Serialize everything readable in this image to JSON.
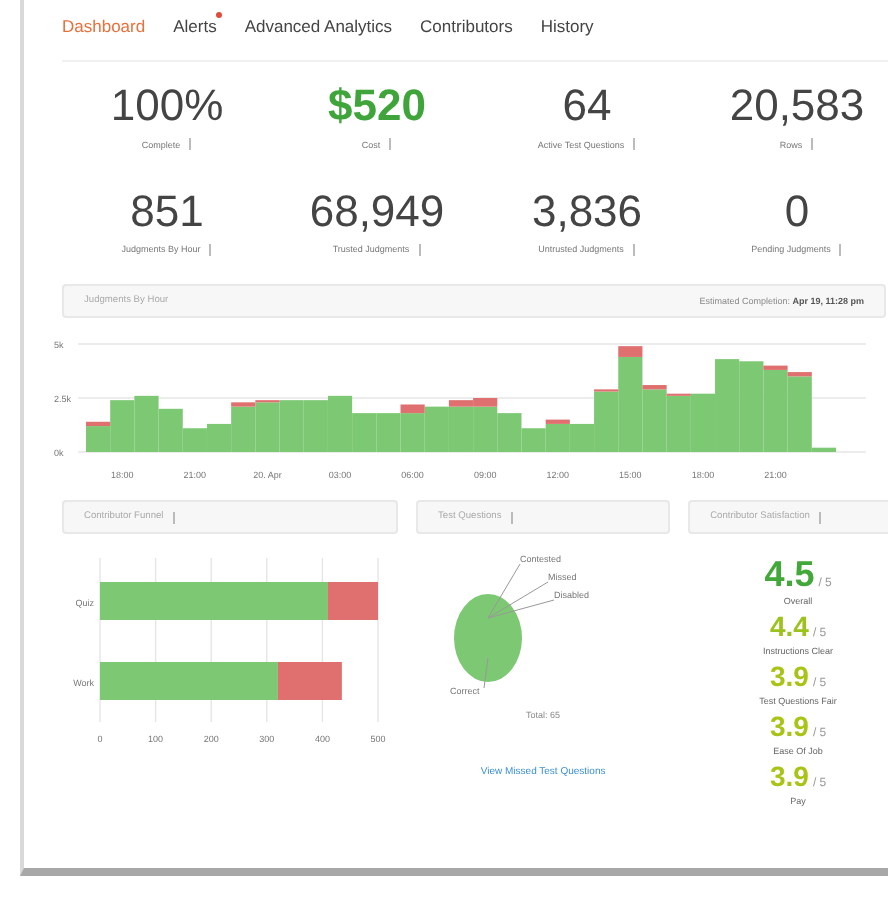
{
  "tabs": [
    {
      "label": "Dashboard",
      "selected": true,
      "alert": false
    },
    {
      "label": "Alerts",
      "selected": false,
      "alert": true
    },
    {
      "label": "Advanced Analytics",
      "selected": false,
      "alert": false
    },
    {
      "label": "Contributors",
      "selected": false,
      "alert": false
    },
    {
      "label": "History",
      "selected": false,
      "alert": false
    }
  ],
  "stats": [
    {
      "value": "100%",
      "label": "Complete",
      "kind": "plain"
    },
    {
      "value": "$520",
      "label": "Cost",
      "kind": "money"
    },
    {
      "value": "64",
      "label": "Active Test Questions",
      "kind": "plain"
    },
    {
      "value": "20,583",
      "label": "Rows",
      "kind": "plain"
    },
    {
      "value": "851",
      "label": "Judgments By Hour",
      "kind": "plain"
    },
    {
      "value": "68,949",
      "label": "Trusted Judgments",
      "kind": "plain"
    },
    {
      "value": "3,836",
      "label": "Untrusted Judgments",
      "kind": "plain"
    },
    {
      "value": "0",
      "label": "Pending Judgments",
      "kind": "plain"
    }
  ],
  "judgments_panel": {
    "title": "Judgments By Hour",
    "completion_label": "Estimated Completion:",
    "completion_value": "Apr 19, 11:28 pm",
    "chart_data": {
      "type": "bar",
      "stacked": true,
      "categories": [
        null,
        "18:00",
        null,
        null,
        "21:00",
        null,
        null,
        "20. Apr",
        null,
        null,
        "03:00",
        null,
        null,
        "06:00",
        null,
        null,
        "09:00",
        null,
        null,
        "12:00",
        null,
        null,
        "15:00",
        null,
        null,
        "18:00",
        null,
        null,
        "21:00",
        null,
        null
      ],
      "ylim": [
        0,
        5000
      ],
      "yticks": [
        {
          "value": 0,
          "label": "0k"
        },
        {
          "value": 2500,
          "label": "2.5k"
        },
        {
          "value": 5000,
          "label": "5k"
        }
      ],
      "series": [
        {
          "color": "#7dc873",
          "values": [
            1200,
            2400,
            2600,
            2000,
            1100,
            1300,
            2100,
            2300,
            2400,
            2400,
            2600,
            1800,
            1800,
            1800,
            2100,
            2100,
            2100,
            1800,
            1100,
            1300,
            1300,
            2800,
            4400,
            2900,
            2600,
            2700,
            4300,
            4200,
            3800,
            3500,
            200
          ]
        },
        {
          "color": "#e07070",
          "values": [
            200,
            0,
            0,
            0,
            0,
            0,
            200,
            100,
            0,
            0,
            0,
            0,
            0,
            400,
            0,
            300,
            400,
            0,
            0,
            200,
            0,
            100,
            500,
            200,
            100,
            0,
            0,
            0,
            200,
            200,
            0
          ]
        }
      ]
    }
  },
  "funnel_panel": {
    "title": "Contributor Funnel",
    "chart_data": {
      "type": "bar",
      "orientation": "horizontal",
      "stacked": true,
      "categories": [
        "Quiz",
        "Work"
      ],
      "xlim": [
        0,
        500
      ],
      "xticks": [
        0,
        100,
        200,
        300,
        400,
        500
      ],
      "grid": true,
      "series": [
        {
          "color": "#7dc873",
          "values": [
            410,
            320
          ]
        },
        {
          "color": "#e07070",
          "values": [
            90,
            115
          ]
        }
      ]
    }
  },
  "test_questions_panel": {
    "title": "Test Questions",
    "pie_labels": [
      "Contested",
      "Missed",
      "Disabled",
      "Correct"
    ],
    "total": "Total: 65",
    "link": "View Missed Test Questions"
  },
  "satisfaction_panel": {
    "title": "Contributor Satisfaction",
    "ratings": [
      {
        "score": "4.5",
        "out_of": "/ 5",
        "label": "Overall",
        "color": "#43a83a"
      },
      {
        "score": "4.4",
        "out_of": "/ 5",
        "label": "Instructions Clear",
        "color": "#9cc21c"
      },
      {
        "score": "3.9",
        "out_of": "/ 5",
        "label": "Test Questions Fair",
        "color": "#a9c317"
      },
      {
        "score": "3.9",
        "out_of": "/ 5",
        "label": "Ease Of Job",
        "color": "#a9c317"
      },
      {
        "score": "3.9",
        "out_of": "/ 5",
        "label": "Pay",
        "color": "#a9c317"
      }
    ]
  }
}
